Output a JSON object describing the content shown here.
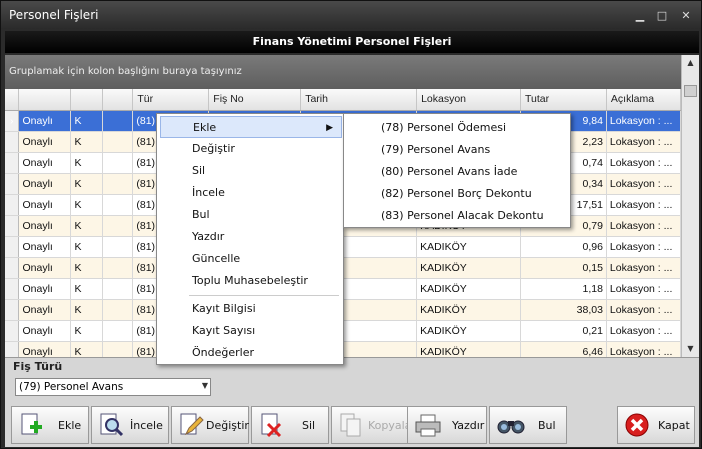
{
  "window": {
    "title": "Personel Fişleri",
    "min": "▭",
    "max": "▭",
    "close": "✕"
  },
  "header": "Finans Yönetimi Personel Fişleri",
  "group_hint": "Gruplamak için kolon başlığını buraya taşıyınız",
  "columns": [
    "",
    "",
    "Tür",
    "Fiş No",
    "Tarih",
    "Lokasyon",
    "Tutar",
    "Açıklama"
  ],
  "rows": [
    {
      "ind": "›",
      "c1": "Onaylı",
      "c2": "K",
      "c3": "",
      "tur": "(81)",
      "fisno": "",
      "tarih": "",
      "lok": "",
      "tutar": "9,84",
      "acik": "Lokasyon : ..."
    },
    {
      "ind": "",
      "c1": "Onaylı",
      "c2": "K",
      "c3": "",
      "tur": "(81)",
      "fisno": "",
      "tarih": "",
      "lok": "",
      "tutar": "2,23",
      "acik": "Lokasyon : ..."
    },
    {
      "ind": "",
      "c1": "Onaylı",
      "c2": "K",
      "c3": "",
      "tur": "(81)",
      "fisno": "",
      "tarih": "",
      "lok": "",
      "tutar": "0,74",
      "acik": "Lokasyon : ..."
    },
    {
      "ind": "",
      "c1": "Onaylı",
      "c2": "K",
      "c3": "",
      "tur": "(81)",
      "fisno": "",
      "tarih": "",
      "lok": "",
      "tutar": "0,34",
      "acik": "Lokasyon : ..."
    },
    {
      "ind": "",
      "c1": "Onaylı",
      "c2": "K",
      "c3": "",
      "tur": "(81)",
      "fisno": "",
      "tarih": "",
      "lok": "",
      "tutar": "17,51",
      "acik": "Lokasyon : ..."
    },
    {
      "ind": "",
      "c1": "Onaylı",
      "c2": "K",
      "c3": "",
      "tur": "(81)",
      "fisno": "",
      "tarih": "",
      "lok": "KADIKÖY",
      "tutar": "0,79",
      "acik": "Lokasyon : ..."
    },
    {
      "ind": "",
      "c1": "Onaylı",
      "c2": "K",
      "c3": "",
      "tur": "(81)",
      "fisno": "",
      "tarih": "3",
      "lok": "KADIKÖY",
      "tutar": "0,96",
      "acik": "Lokasyon : ..."
    },
    {
      "ind": "",
      "c1": "Onaylı",
      "c2": "K",
      "c3": "",
      "tur": "(81)",
      "fisno": "",
      "tarih": "3",
      "lok": "KADIKÖY",
      "tutar": "0,15",
      "acik": "Lokasyon : ..."
    },
    {
      "ind": "",
      "c1": "Onaylı",
      "c2": "K",
      "c3": "",
      "tur": "(81)",
      "fisno": "",
      "tarih": "3",
      "lok": "KADIKÖY",
      "tutar": "1,18",
      "acik": "Lokasyon : ..."
    },
    {
      "ind": "",
      "c1": "Onaylı",
      "c2": "K",
      "c3": "",
      "tur": "(81)",
      "fisno": "",
      "tarih": "3",
      "lok": "KADIKÖY",
      "tutar": "38,03",
      "acik": "Lokasyon : ..."
    },
    {
      "ind": "",
      "c1": "Onaylı",
      "c2": "K",
      "c3": "",
      "tur": "(81)",
      "fisno": "",
      "tarih": "3",
      "lok": "KADIKÖY",
      "tutar": "0,21",
      "acik": "Lokasyon : ..."
    },
    {
      "ind": "",
      "c1": "Onaylı",
      "c2": "K",
      "c3": "",
      "tur": "(81)",
      "fisno": "",
      "tarih": "3",
      "lok": "KADIKÖY",
      "tutar": "6,46",
      "acik": "Lokasyon : ..."
    }
  ],
  "context_menu": [
    "Ekle",
    "Değiştir",
    "Sil",
    "İncele",
    "Bul",
    "Yazdır",
    "Güncelle",
    "Toplu Muhasebeleştir",
    "Kayıt Bilgisi",
    "Kayıt Sayısı",
    "Öndeğerler"
  ],
  "submenu": [
    "(78) Personel Ödemesi",
    "(79) Personel Avans",
    "(80) Personel Avans İade",
    "(82) Personel Borç Dekontu",
    "(83) Personel Alacak Dekontu"
  ],
  "fis_turu": {
    "label": "Fiş Türü",
    "value": "(79) Personel Avans"
  },
  "toolbar": {
    "ekle": "Ekle",
    "incele": "İncele",
    "degistir": "Değiştir",
    "sil": "Sil",
    "kopyala": "Kopyala",
    "yazdir": "Yazdır",
    "bul": "Bul",
    "kapat": "Kapat"
  },
  "colors": {
    "selection": "#3b6fd6",
    "row_alt": "#fdf6e6",
    "menu_highlight": "#dce8fb"
  },
  "icons": [
    "add-document-icon",
    "magnifier-icon",
    "edit-pencil-icon",
    "delete-document-icon",
    "copy-icon",
    "printer-icon",
    "binoculars-icon",
    "close-icon"
  ]
}
